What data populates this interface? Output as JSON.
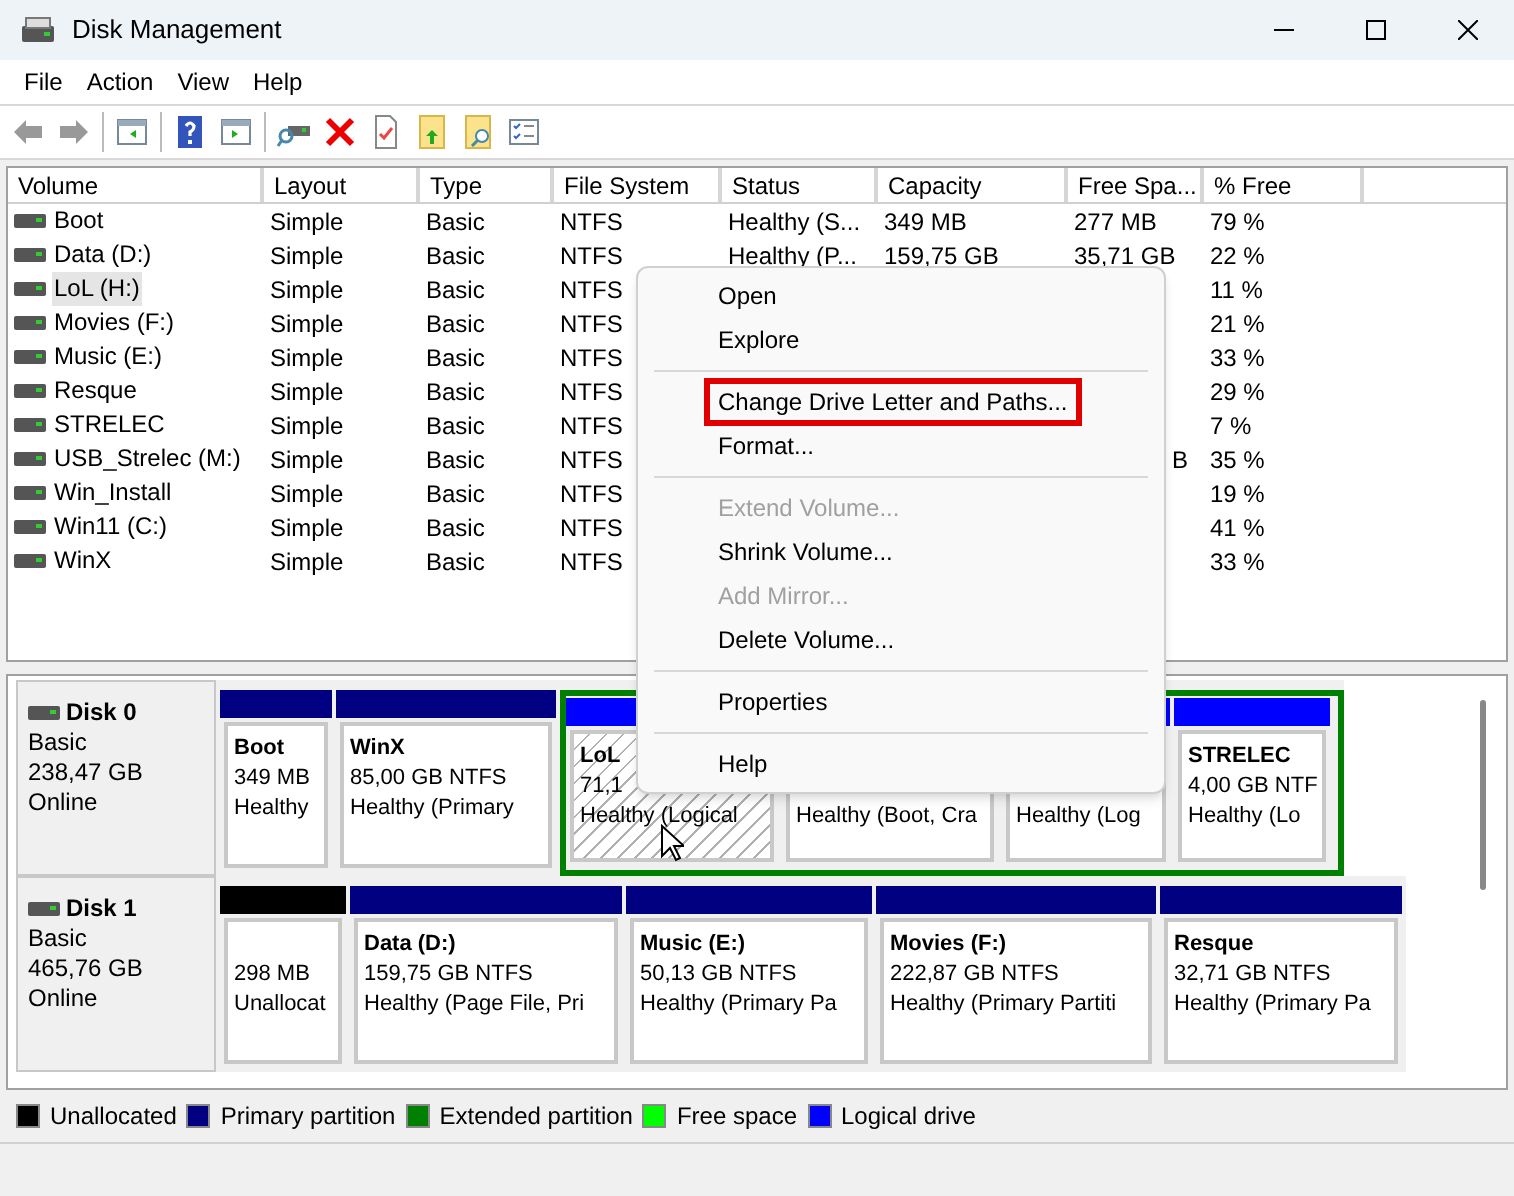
{
  "window": {
    "title": "Disk Management"
  },
  "menu_bar": [
    "File",
    "Action",
    "View",
    "Help"
  ],
  "table": {
    "columns": [
      "Volume",
      "Layout",
      "Type",
      "File System",
      "Status",
      "Capacity",
      "Free Spa...",
      "% Free"
    ],
    "rows": [
      {
        "volume": "Boot",
        "layout": "Simple",
        "type": "Basic",
        "file_system": "NTFS",
        "status": "Healthy (S...",
        "capacity": "349 MB",
        "free_space": "277 MB",
        "percent_free": "79 %",
        "selected": false
      },
      {
        "volume": "Data (D:)",
        "layout": "Simple",
        "type": "Basic",
        "file_system": "NTFS",
        "status": "Healthy (P...",
        "capacity": "159,75 GB",
        "free_space": "35,71 GB",
        "percent_free": "22 %",
        "selected": false
      },
      {
        "volume": "LoL (H:)",
        "layout": "Simple",
        "type": "Basic",
        "file_system": "NTFS",
        "percent_free": "11 %",
        "selected": true
      },
      {
        "volume": "Movies (F:)",
        "layout": "Simple",
        "type": "Basic",
        "file_system": "NTFS",
        "percent_free": "21 %",
        "selected": false
      },
      {
        "volume": "Music (E:)",
        "layout": "Simple",
        "type": "Basic",
        "file_system": "NTFS",
        "percent_free": "33 %",
        "selected": false
      },
      {
        "volume": "Resque",
        "layout": "Simple",
        "type": "Basic",
        "file_system": "NTFS",
        "percent_free": "29 %",
        "selected": false
      },
      {
        "volume": "STRELEC",
        "layout": "Simple",
        "type": "Basic",
        "file_system": "NTFS",
        "percent_free": "7 %",
        "selected": false
      },
      {
        "volume": "USB_Strelec (M:)",
        "layout": "Simple",
        "type": "Basic",
        "file_system": "NTFS",
        "free_space": "B",
        "free_space_clipped": true,
        "percent_free": "35 %",
        "selected": false
      },
      {
        "volume": "Win_Install",
        "layout": "Simple",
        "type": "Basic",
        "file_system": "NTFS",
        "percent_free": "19 %",
        "selected": false
      },
      {
        "volume": "Win11 (C:)",
        "layout": "Simple",
        "type": "Basic",
        "file_system": "NTFS",
        "percent_free": "41 %",
        "selected": false
      },
      {
        "volume": "WinX",
        "layout": "Simple",
        "type": "Basic",
        "file_system": "NTFS",
        "percent_free": "33 %",
        "selected": false
      }
    ]
  },
  "context_menu": {
    "items": [
      {
        "kind": "item",
        "label": "Open",
        "disabled": false,
        "boxed": false
      },
      {
        "kind": "item",
        "label": "Explore",
        "disabled": false,
        "boxed": false
      },
      {
        "kind": "separator"
      },
      {
        "kind": "item",
        "label": "Change Drive Letter and Paths...",
        "disabled": false,
        "boxed": true
      },
      {
        "kind": "item",
        "label": "Format...",
        "disabled": false,
        "boxed": false
      },
      {
        "kind": "separator"
      },
      {
        "kind": "item",
        "label": "Extend Volume...",
        "disabled": true,
        "boxed": false
      },
      {
        "kind": "item",
        "label": "Shrink Volume...",
        "disabled": false,
        "boxed": false
      },
      {
        "kind": "item",
        "label": "Add Mirror...",
        "disabled": true,
        "boxed": false
      },
      {
        "kind": "item",
        "label": "Delete Volume...",
        "disabled": false,
        "boxed": false
      },
      {
        "kind": "separator"
      },
      {
        "kind": "item",
        "label": "Properties",
        "disabled": false,
        "boxed": false
      },
      {
        "kind": "separator"
      },
      {
        "kind": "item",
        "label": "Help",
        "disabled": false,
        "boxed": false
      }
    ]
  },
  "disks": [
    {
      "name": "Disk 0",
      "type": "Basic",
      "size": "238,47 GB",
      "status": "Online",
      "partitions": [
        {
          "kind": "primary",
          "name": "Boot",
          "size": "349 MB",
          "status": "Healthy",
          "selected": false
        },
        {
          "kind": "primary",
          "name": "WinX",
          "size": "85,00 GB NTFS",
          "status": "Healthy (Primary",
          "selected": false
        },
        {
          "kind": "extended",
          "children": [
            {
              "kind": "logical",
              "name": "LoL",
              "size": "71,1",
              "status": "Healthy (Logical",
              "selected": true
            },
            {
              "kind": "logical",
              "status": "Healthy (Boot, Cra",
              "selected": false
            },
            {
              "kind": "logical",
              "status": "Healthy (Log",
              "selected": false
            },
            {
              "kind": "logical",
              "name": "STRELEC",
              "size": "4,00 GB NTF",
              "status": "Healthy (Lo",
              "selected": false
            }
          ]
        }
      ]
    },
    {
      "name": "Disk 1",
      "type": "Basic",
      "size": "465,76 GB",
      "status": "Online",
      "partitions": [
        {
          "kind": "unallocated",
          "size": "298 MB",
          "status": "Unallocat",
          "selected": false
        },
        {
          "kind": "primary",
          "name": "Data  (D:)",
          "size": "159,75 GB NTFS",
          "status": "Healthy (Page File, Pri",
          "selected": false
        },
        {
          "kind": "primary",
          "name": "Music  (E:)",
          "size": "50,13 GB NTFS",
          "status": "Healthy (Primary Pa",
          "selected": false
        },
        {
          "kind": "primary",
          "name": "Movies  (F:)",
          "size": "222,87 GB NTFS",
          "status": "Healthy (Primary Partiti",
          "selected": false
        },
        {
          "kind": "primary",
          "name": "Resque",
          "size": "32,71 GB NTFS",
          "status": "Healthy (Primary Pa",
          "selected": false
        }
      ]
    }
  ],
  "legend": [
    {
      "label": "Unallocated",
      "color": "#000000"
    },
    {
      "label": "Primary partition",
      "color": "#000080"
    },
    {
      "label": "Extended partition",
      "color": "#008000"
    },
    {
      "label": "Free space",
      "color": "#00ff00"
    },
    {
      "label": "Logical drive",
      "color": "#0000ff"
    }
  ]
}
